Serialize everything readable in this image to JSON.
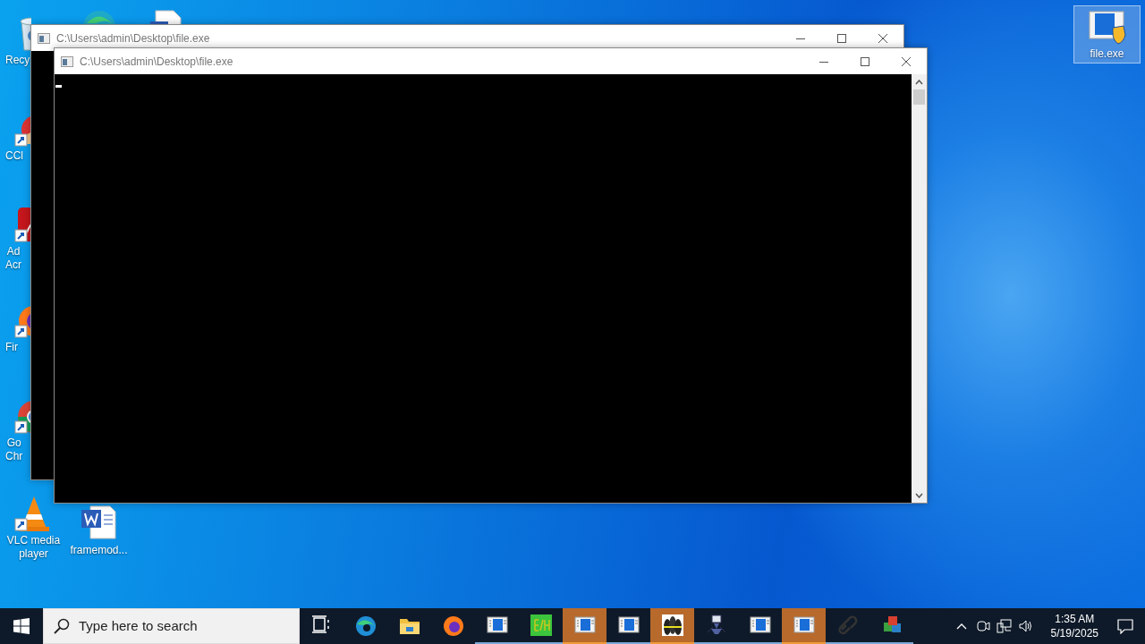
{
  "desktop_icons": [
    {
      "kind": "recycle-bin",
      "lines": [
        "Recy"
      ],
      "selected": false
    },
    {
      "kind": "ccleaner",
      "lines": [
        "CCl"
      ],
      "selected": false
    },
    {
      "kind": "acrobat",
      "lines": [
        "Ad",
        "Acr"
      ],
      "selected": false
    },
    {
      "kind": "firefox",
      "lines": [
        "Fir"
      ],
      "selected": false
    },
    {
      "kind": "chrome",
      "lines": [
        "Go",
        "Chr"
      ],
      "selected": false
    },
    {
      "kind": "vlc",
      "lines": [
        "VLC media",
        "player"
      ],
      "selected": false
    },
    {
      "kind": "edge",
      "selected": false
    },
    {
      "kind": "word",
      "lines": [
        "framemod..."
      ],
      "selected": false
    },
    {
      "kind": "document",
      "selected": false
    },
    {
      "kind": "exe",
      "lines": [
        "file.exe"
      ],
      "selected": true
    }
  ],
  "windows": [
    {
      "title": "C:\\Users\\admin\\Desktop\\file.exe"
    },
    {
      "title": "C:\\Users\\admin\\Desktop\\file.exe"
    }
  ],
  "taskbar": {
    "search": {
      "placeholder": "Type here to search"
    },
    "apps": [
      {
        "kind": "task-view",
        "running": false,
        "flashing": false
      },
      {
        "kind": "edge",
        "running": false,
        "flashing": false
      },
      {
        "kind": "explorer",
        "running": false,
        "flashing": false
      },
      {
        "kind": "firefox",
        "running": false,
        "flashing": false
      },
      {
        "kind": "console",
        "running": true,
        "flashing": false
      },
      {
        "kind": "bh",
        "running": true,
        "flashing": false
      },
      {
        "kind": "console",
        "running": true,
        "flashing": true
      },
      {
        "kind": "console",
        "running": true,
        "flashing": false
      },
      {
        "kind": "tiles",
        "running": true,
        "flashing": true
      },
      {
        "kind": "bot",
        "running": true,
        "flashing": false
      },
      {
        "kind": "console",
        "running": true,
        "flashing": false
      },
      {
        "kind": "console",
        "running": true,
        "flashing": true
      },
      {
        "kind": "link",
        "running": true,
        "flashing": false
      },
      {
        "kind": "mc",
        "running": true,
        "flashing": false
      }
    ],
    "time": "1:35 AM",
    "date": "5/19/2025"
  }
}
